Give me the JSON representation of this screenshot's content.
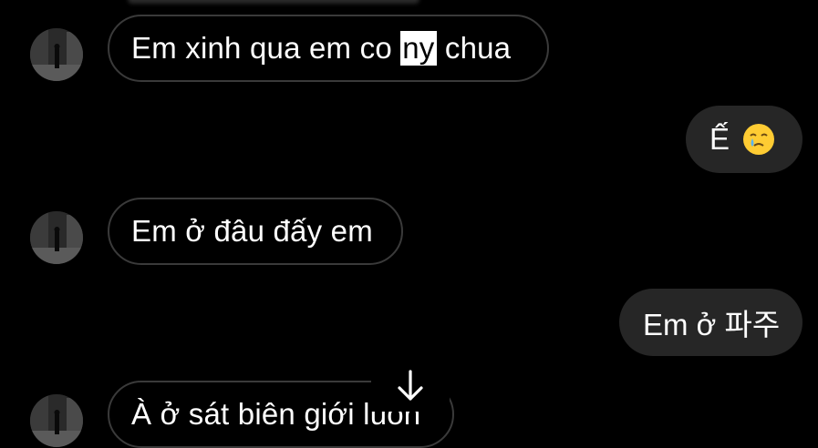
{
  "messages": [
    {
      "side": "in",
      "text_before": "Em xinh qua em co ",
      "text_highlight": "ny",
      "text_after": " chua"
    },
    {
      "side": "out",
      "text": "Ế",
      "emoji": "face-holding-back-tears"
    },
    {
      "side": "in",
      "text": "Em ở đâu đấy em"
    },
    {
      "side": "out",
      "text": "Em ở 파주"
    },
    {
      "side": "in",
      "text": "À ở sát biên giới luôn"
    }
  ],
  "icons": {
    "scroll": "arrow-down-icon",
    "avatar": "profile-avatar"
  },
  "colors": {
    "background": "#000000",
    "incoming_border": "#3a3a3a",
    "outgoing_fill": "#262626",
    "text": "#ffffff"
  }
}
